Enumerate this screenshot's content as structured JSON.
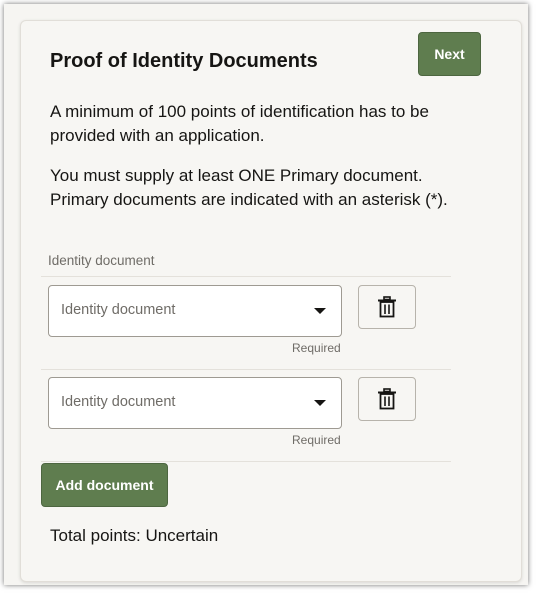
{
  "card": {
    "title": "Proof of Identity Documents",
    "next_label": "Next",
    "intro_1": "A minimum of 100 points of identification has to be provided with an application.",
    "intro_2": "You must supply at least ONE Primary document. Primary documents are indicated with an asterisk (*).",
    "field_header": "Identity document",
    "rows": [
      {
        "placeholder": "Identity document",
        "hint": "Required",
        "delete_icon": "trash-icon"
      },
      {
        "placeholder": "Identity document",
        "hint": "Required",
        "delete_icon": "trash-icon"
      }
    ],
    "add_label": "Add document",
    "total_label": "Total points: Uncertain"
  },
  "colors": {
    "primary_button": "#5f7d4f",
    "card_background": "#f7f6f3",
    "input_border": "#9e9a92"
  }
}
